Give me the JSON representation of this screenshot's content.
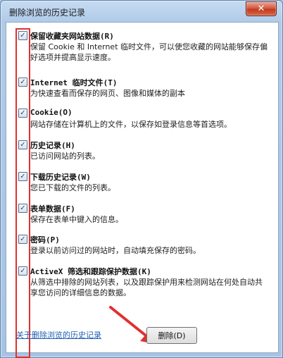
{
  "window": {
    "title": "删除浏览的历史记录",
    "close_glyph": "✕"
  },
  "items": [
    {
      "title": "保留收藏夹网站数据(R)",
      "desc": "保留 Cookie 和 Internet 临时文件，可以使您收藏的网站能够保存偏好选项并提高显示速度。",
      "checked": true
    },
    {
      "title": "Internet 临时文件(T)",
      "desc": "为快速查看而保存的网页、图像和媒体的副本",
      "checked": true
    },
    {
      "title": "Cookie(O)",
      "desc": "网站存储在计算机上的文件，以保存如登录信息等首选项。",
      "checked": true
    },
    {
      "title": "历史记录(H)",
      "desc": "已访问网站的列表。",
      "checked": true
    },
    {
      "title": "下载历史记录(W)",
      "desc": "您已下载的文件的列表。",
      "checked": true
    },
    {
      "title": "表单数据(F)",
      "desc": "保存在表单中键入的信息。",
      "checked": true
    },
    {
      "title": "密码(P)",
      "desc": "登录以前访问过的网站时，自动填充保存的密码。",
      "checked": true
    },
    {
      "title": "ActiveX 筛选和跟踪保护数据(K)",
      "desc": "从筛选中排除的网站列表，以及跟踪保护用来检测网站在何处自动共享您访问的详细信息的数据。",
      "checked": true
    }
  ],
  "footer": {
    "about_link": "关于删除浏览的历史记录",
    "delete_label": "删除(D)"
  },
  "colors": {
    "highlight": "#e03030",
    "link": "#1f5fb3"
  }
}
